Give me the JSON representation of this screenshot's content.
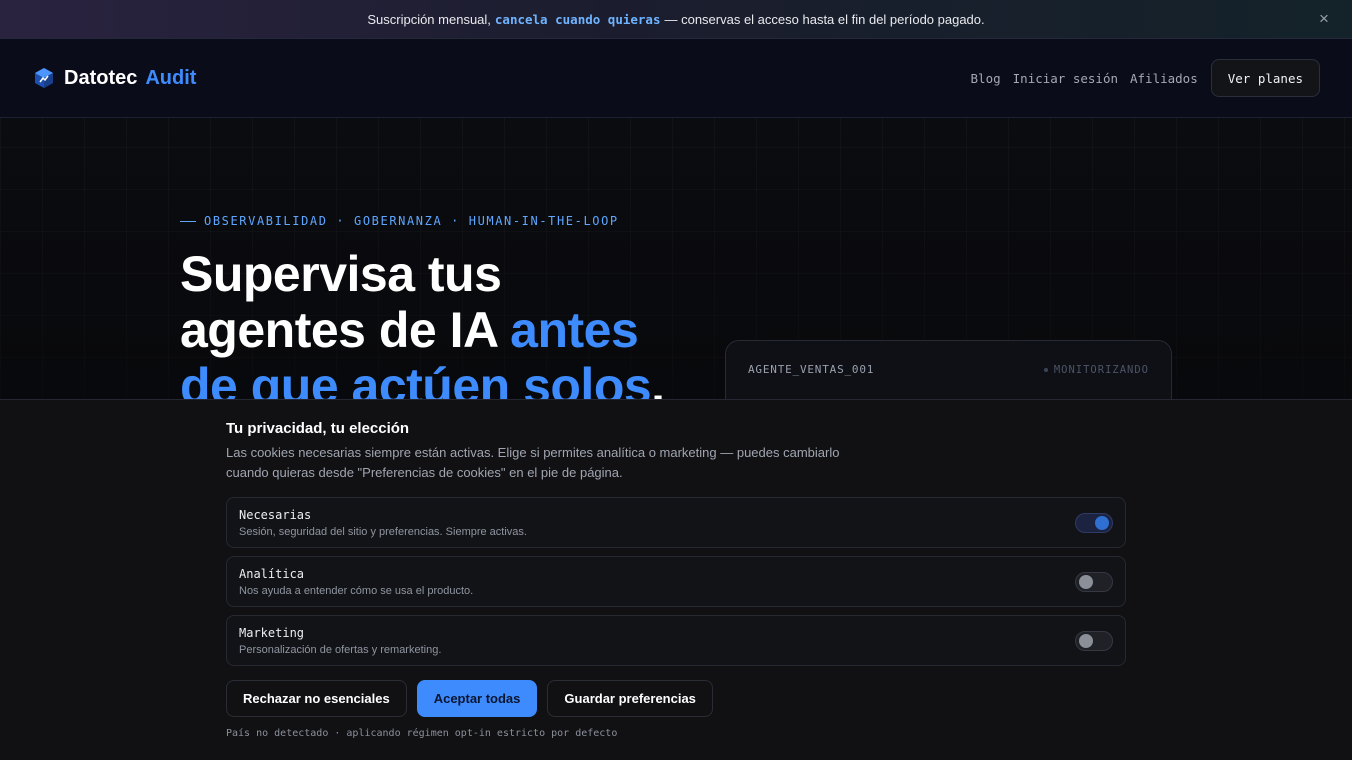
{
  "announcement": {
    "text_before": "Suscripción mensual,",
    "highlight": "cancela cuando quieras",
    "text_after": "— conservas el acceso hasta el fin del período pagado.",
    "close_icon": "×"
  },
  "nav": {
    "brand_part1": "Datotec",
    "brand_part2": "Audit",
    "links": [
      "Blog",
      "Iniciar sesión",
      "Afiliados"
    ],
    "cta": "Ver planes"
  },
  "hero": {
    "eyebrow": "OBSERVABILIDAD · GOBERNANZA · HUMAN-IN-THE-LOOP",
    "headline_line1": "Supervisa tus",
    "headline_line2a": "agentes de IA ",
    "headline_line2b": "antes",
    "headline_line3a": "de que actúen solos",
    "headline_line3b": "."
  },
  "agent_card": {
    "agent_id": "AGENTE_VENTAS_001",
    "status": "MONITORIZANDO"
  },
  "cookie": {
    "title": "Tu privacidad, tu elección",
    "description": "Las cookies necesarias siempre están activas. Elige si permites analítica o marketing — puedes cambiarlo cuando quieras desde \"Preferencias de cookies\" en el pie de página.",
    "prefs": [
      {
        "name": "Necesarias",
        "desc": "Sesión, seguridad del sitio y preferencias. Siempre activas.",
        "enabled": true
      },
      {
        "name": "Analítica",
        "desc": "Nos ayuda a entender cómo se usa el producto.",
        "enabled": false
      },
      {
        "name": "Marketing",
        "desc": "Personalización de ofertas y remarketing.",
        "enabled": false
      }
    ],
    "buttons": {
      "reject": "Rechazar no esenciales",
      "accept": "Aceptar todas",
      "save": "Guardar preferencias"
    },
    "footnote": "País no detectado · aplicando régimen opt-in estricto por defecto"
  },
  "colors": {
    "accent": "#3d8bfd",
    "background": "#0b0b0d"
  }
}
